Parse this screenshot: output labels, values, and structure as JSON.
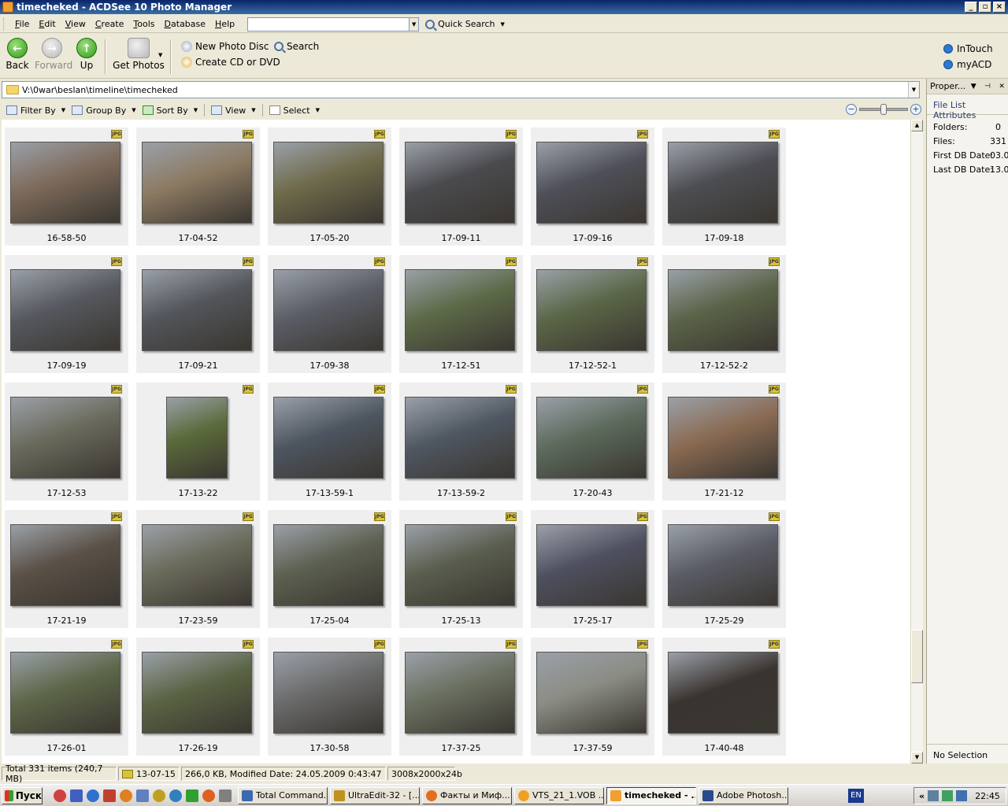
{
  "window": {
    "title": "timecheked - ACDSee 10 Photo Manager",
    "btn_min": "_",
    "btn_restore": "▫",
    "btn_close": "×"
  },
  "menu": [
    "File",
    "Edit",
    "View",
    "Create",
    "Tools",
    "Database",
    "Help"
  ],
  "quick_search": {
    "label": "Quick Search",
    "value": ""
  },
  "toolbar": {
    "back": "Back",
    "forward": "Forward",
    "up": "Up",
    "get_photos": "Get Photos",
    "new_photo_disc": "New Photo Disc",
    "create_cd": "Create CD or DVD",
    "search": "Search",
    "intouch": "InTouch",
    "myacd": "myACD"
  },
  "path": "V:\\0war\\beslan\\timeline\\timecheked",
  "filterbar": {
    "filter": "Filter By",
    "group": "Group By",
    "sort": "Sort By",
    "view": "View",
    "select": "Select"
  },
  "thumbnail_badge": "JPG",
  "thumbnails": [
    {
      "name": "16-58-50",
      "bg": "#7d6a5a"
    },
    {
      "name": "17-04-52",
      "bg": "#8c7a62"
    },
    {
      "name": "17-05-20",
      "bg": "#6e6a4a"
    },
    {
      "name": "17-09-11",
      "bg": "#4a4a4e"
    },
    {
      "name": "17-09-16",
      "bg": "#4e4f58"
    },
    {
      "name": "17-09-18",
      "bg": "#4c4d52"
    },
    {
      "name": "17-09-19",
      "bg": "#55585e"
    },
    {
      "name": "17-09-21",
      "bg": "#52555a"
    },
    {
      "name": "17-09-38",
      "bg": "#5a5d66"
    },
    {
      "name": "17-12-51",
      "bg": "#5c6a48"
    },
    {
      "name": "17-12-52-1",
      "bg": "#5a6646"
    },
    {
      "name": "17-12-52-2",
      "bg": "#5a6448"
    },
    {
      "name": "17-12-53",
      "bg": "#6a6a5c"
    },
    {
      "name": "17-13-22",
      "bg": "#5a6a3a"
    },
    {
      "name": "17-13-59-1",
      "bg": "#4d5560"
    },
    {
      "name": "17-13-59-2",
      "bg": "#4f5762"
    },
    {
      "name": "17-20-43",
      "bg": "#5c6a5c"
    },
    {
      "name": "17-21-12",
      "bg": "#8a6a52"
    },
    {
      "name": "17-21-19",
      "bg": "#5a5046"
    },
    {
      "name": "17-23-59",
      "bg": "#6a6a5a"
    },
    {
      "name": "17-25-04",
      "bg": "#5c6050"
    },
    {
      "name": "17-25-13",
      "bg": "#5a5e4e"
    },
    {
      "name": "17-25-17",
      "bg": "#4e5060"
    },
    {
      "name": "17-25-29",
      "bg": "#5a5c66"
    },
    {
      "name": "17-26-01",
      "bg": "#5c6648"
    },
    {
      "name": "17-26-19",
      "bg": "#5a6444"
    },
    {
      "name": "17-30-58",
      "bg": "#6a6a6a"
    },
    {
      "name": "17-37-25",
      "bg": "#6a7060"
    },
    {
      "name": "17-37-59",
      "bg": "#8a8c84"
    },
    {
      "name": "17-40-48",
      "bg": "#3a3430"
    }
  ],
  "properties": {
    "title": "Proper...",
    "tab": "File List Attributes",
    "rows": [
      {
        "k": "Folders:",
        "v": "0"
      },
      {
        "k": "Files:",
        "v": "331"
      },
      {
        "k": "First DB Date:",
        "v": "03.0"
      },
      {
        "k": "Last DB Date:",
        "v": "13.0"
      }
    ],
    "no_selection": "No Selection"
  },
  "status": {
    "total": "Total 331 items  (240,7 MB)",
    "current": "13-07-15",
    "info": "266,0 KB, Modified Date: 24.05.2009 0:43:47",
    "dims": "3008x2000x24b"
  },
  "taskbar": {
    "start": "Пуск",
    "tasks": [
      "Total Command...",
      "UltraEdit-32 - [...",
      "Факты и Миф...",
      "VTS_21_1.VOB ...",
      "timecheked - ...",
      "Adobe Photosh..."
    ],
    "lang": "EN",
    "tray_arrows": "«",
    "clock": "22:45"
  }
}
